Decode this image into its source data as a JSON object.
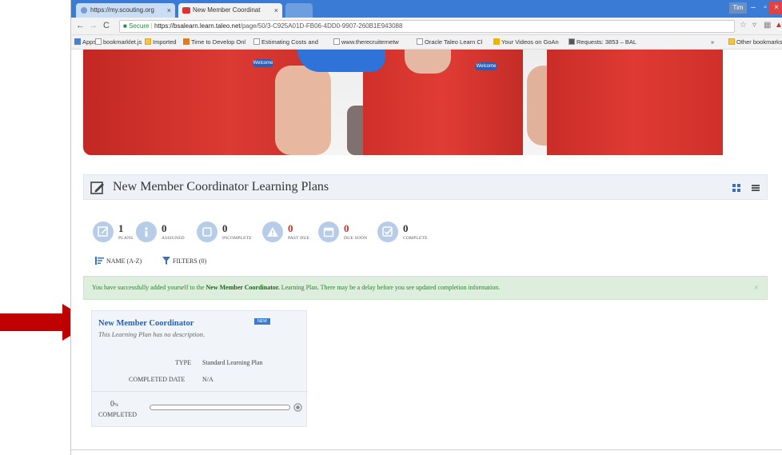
{
  "browser": {
    "tabs": [
      {
        "label": "https://my.scouting.org",
        "active": false
      },
      {
        "label": "New Member Coordinat",
        "active": true
      },
      {
        "label": "",
        "active": false
      }
    ],
    "user_chip": "Tim",
    "url": {
      "secure_label": "Secure",
      "host": "https://bsalearn.learn.taleo.net",
      "path": "/page/50/3-C925A01D-FB06-4DD0-9907-260B1E943088"
    },
    "bookmarks": [
      {
        "label": "Apps",
        "icon": "apps-icon"
      },
      {
        "label": "bookmarklet.js",
        "icon": "page-icon"
      },
      {
        "label": "Imported",
        "icon": "folder-icon"
      },
      {
        "label": "Time to Develop Onl",
        "icon": "chart-icon"
      },
      {
        "label": "Estimating Costs and",
        "icon": "page-icon"
      },
      {
        "label": "www.therecruiternetw",
        "icon": "page-icon"
      },
      {
        "label": "Oracle Taleo Learn Cl",
        "icon": "page-icon"
      },
      {
        "label": "Your Videos on GoAn",
        "icon": "video-icon"
      },
      {
        "label": "Requests: 3853 – BAL",
        "icon": "page-icon"
      },
      {
        "label": "»",
        "icon": ""
      },
      {
        "label": "Other bookmarks",
        "icon": "folder-icon"
      }
    ]
  },
  "hero": {
    "badge_left": "Welcome",
    "badge_right": "Welcome"
  },
  "page": {
    "title": "New Member Coordinator Learning Plans"
  },
  "stats": [
    {
      "value": "1",
      "label": "PLANS",
      "icon": "edit-icon",
      "alert": false
    },
    {
      "value": "0",
      "label": "ASSIGNED",
      "icon": "info-icon",
      "alert": false
    },
    {
      "value": "0",
      "label": "INCOMPLETE",
      "icon": "square-icon",
      "alert": false
    },
    {
      "value": "0",
      "label": "PAST DUE",
      "icon": "warning-icon",
      "alert": true
    },
    {
      "value": "0",
      "label": "DUE SOON",
      "icon": "calendar-icon",
      "alert": true
    },
    {
      "value": "0",
      "label": "COMPLETE",
      "icon": "check-icon",
      "alert": false
    }
  ],
  "sort": {
    "name_label": "NAME (A-Z)",
    "filters_label": "FILTERS (0)"
  },
  "alert": {
    "prefix": "You have successfully added yourself to the ",
    "bold": "New Member Coordinator.",
    "suffix": " Learning Plan. There may be a delay before you see updated completion information.",
    "close": "×"
  },
  "card": {
    "title": "New Member Coordinator",
    "badge": "NEW",
    "description": "This Learning Plan has no description.",
    "type_key": "TYPE",
    "type_value": "Standard Learning Plan",
    "completed_date_key": "COMPLETED DATE",
    "completed_date_value": "N/A",
    "percent": "0",
    "percent_sign": "%",
    "completed_label": "COMPLETED",
    "progress": 0
  },
  "colors": {
    "accent": "#2a5ea8",
    "alert_bg": "#ddeedd",
    "stat_circle": "#b7cce7",
    "arrow": "#c00000"
  }
}
